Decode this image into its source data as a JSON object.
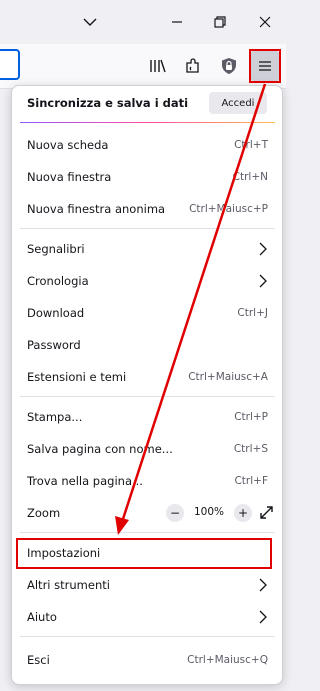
{
  "sync": {
    "label": "Sincronizza e salva i dati",
    "signin_button": "Accedi"
  },
  "group1": [
    {
      "label": "Nuova scheda",
      "shortcut": "Ctrl+T"
    },
    {
      "label": "Nuova finestra",
      "shortcut": "Ctrl+N"
    },
    {
      "label": "Nuova finestra anonima",
      "shortcut": "Ctrl+Maiusc+P"
    }
  ],
  "group2": [
    {
      "label": "Segnalibri"
    },
    {
      "label": "Cronologia"
    },
    {
      "label": "Download",
      "shortcut": "Ctrl+J"
    },
    {
      "label": "Password"
    },
    {
      "label": "Estensioni e temi",
      "shortcut": "Ctrl+Maiusc+A"
    }
  ],
  "group3": [
    {
      "label": "Stampa...",
      "shortcut": "Ctrl+P"
    },
    {
      "label": "Salva pagina con nome...",
      "shortcut": "Ctrl+S"
    },
    {
      "label": "Trova nella pagina...",
      "shortcut": "Ctrl+F"
    }
  ],
  "zoom": {
    "label": "Zoom",
    "value": "100%",
    "minus": "−",
    "plus": "+"
  },
  "group4": [
    {
      "label": "Impostazioni"
    },
    {
      "label": "Altri strumenti"
    },
    {
      "label": "Aiuto"
    }
  ],
  "exit": {
    "label": "Esci",
    "shortcut": "Ctrl+Maiusc+Q"
  },
  "colors": {
    "annotation": "#e00000",
    "panel_bg": "#ffffff",
    "toolbar_bg": "#f9f9fb"
  }
}
